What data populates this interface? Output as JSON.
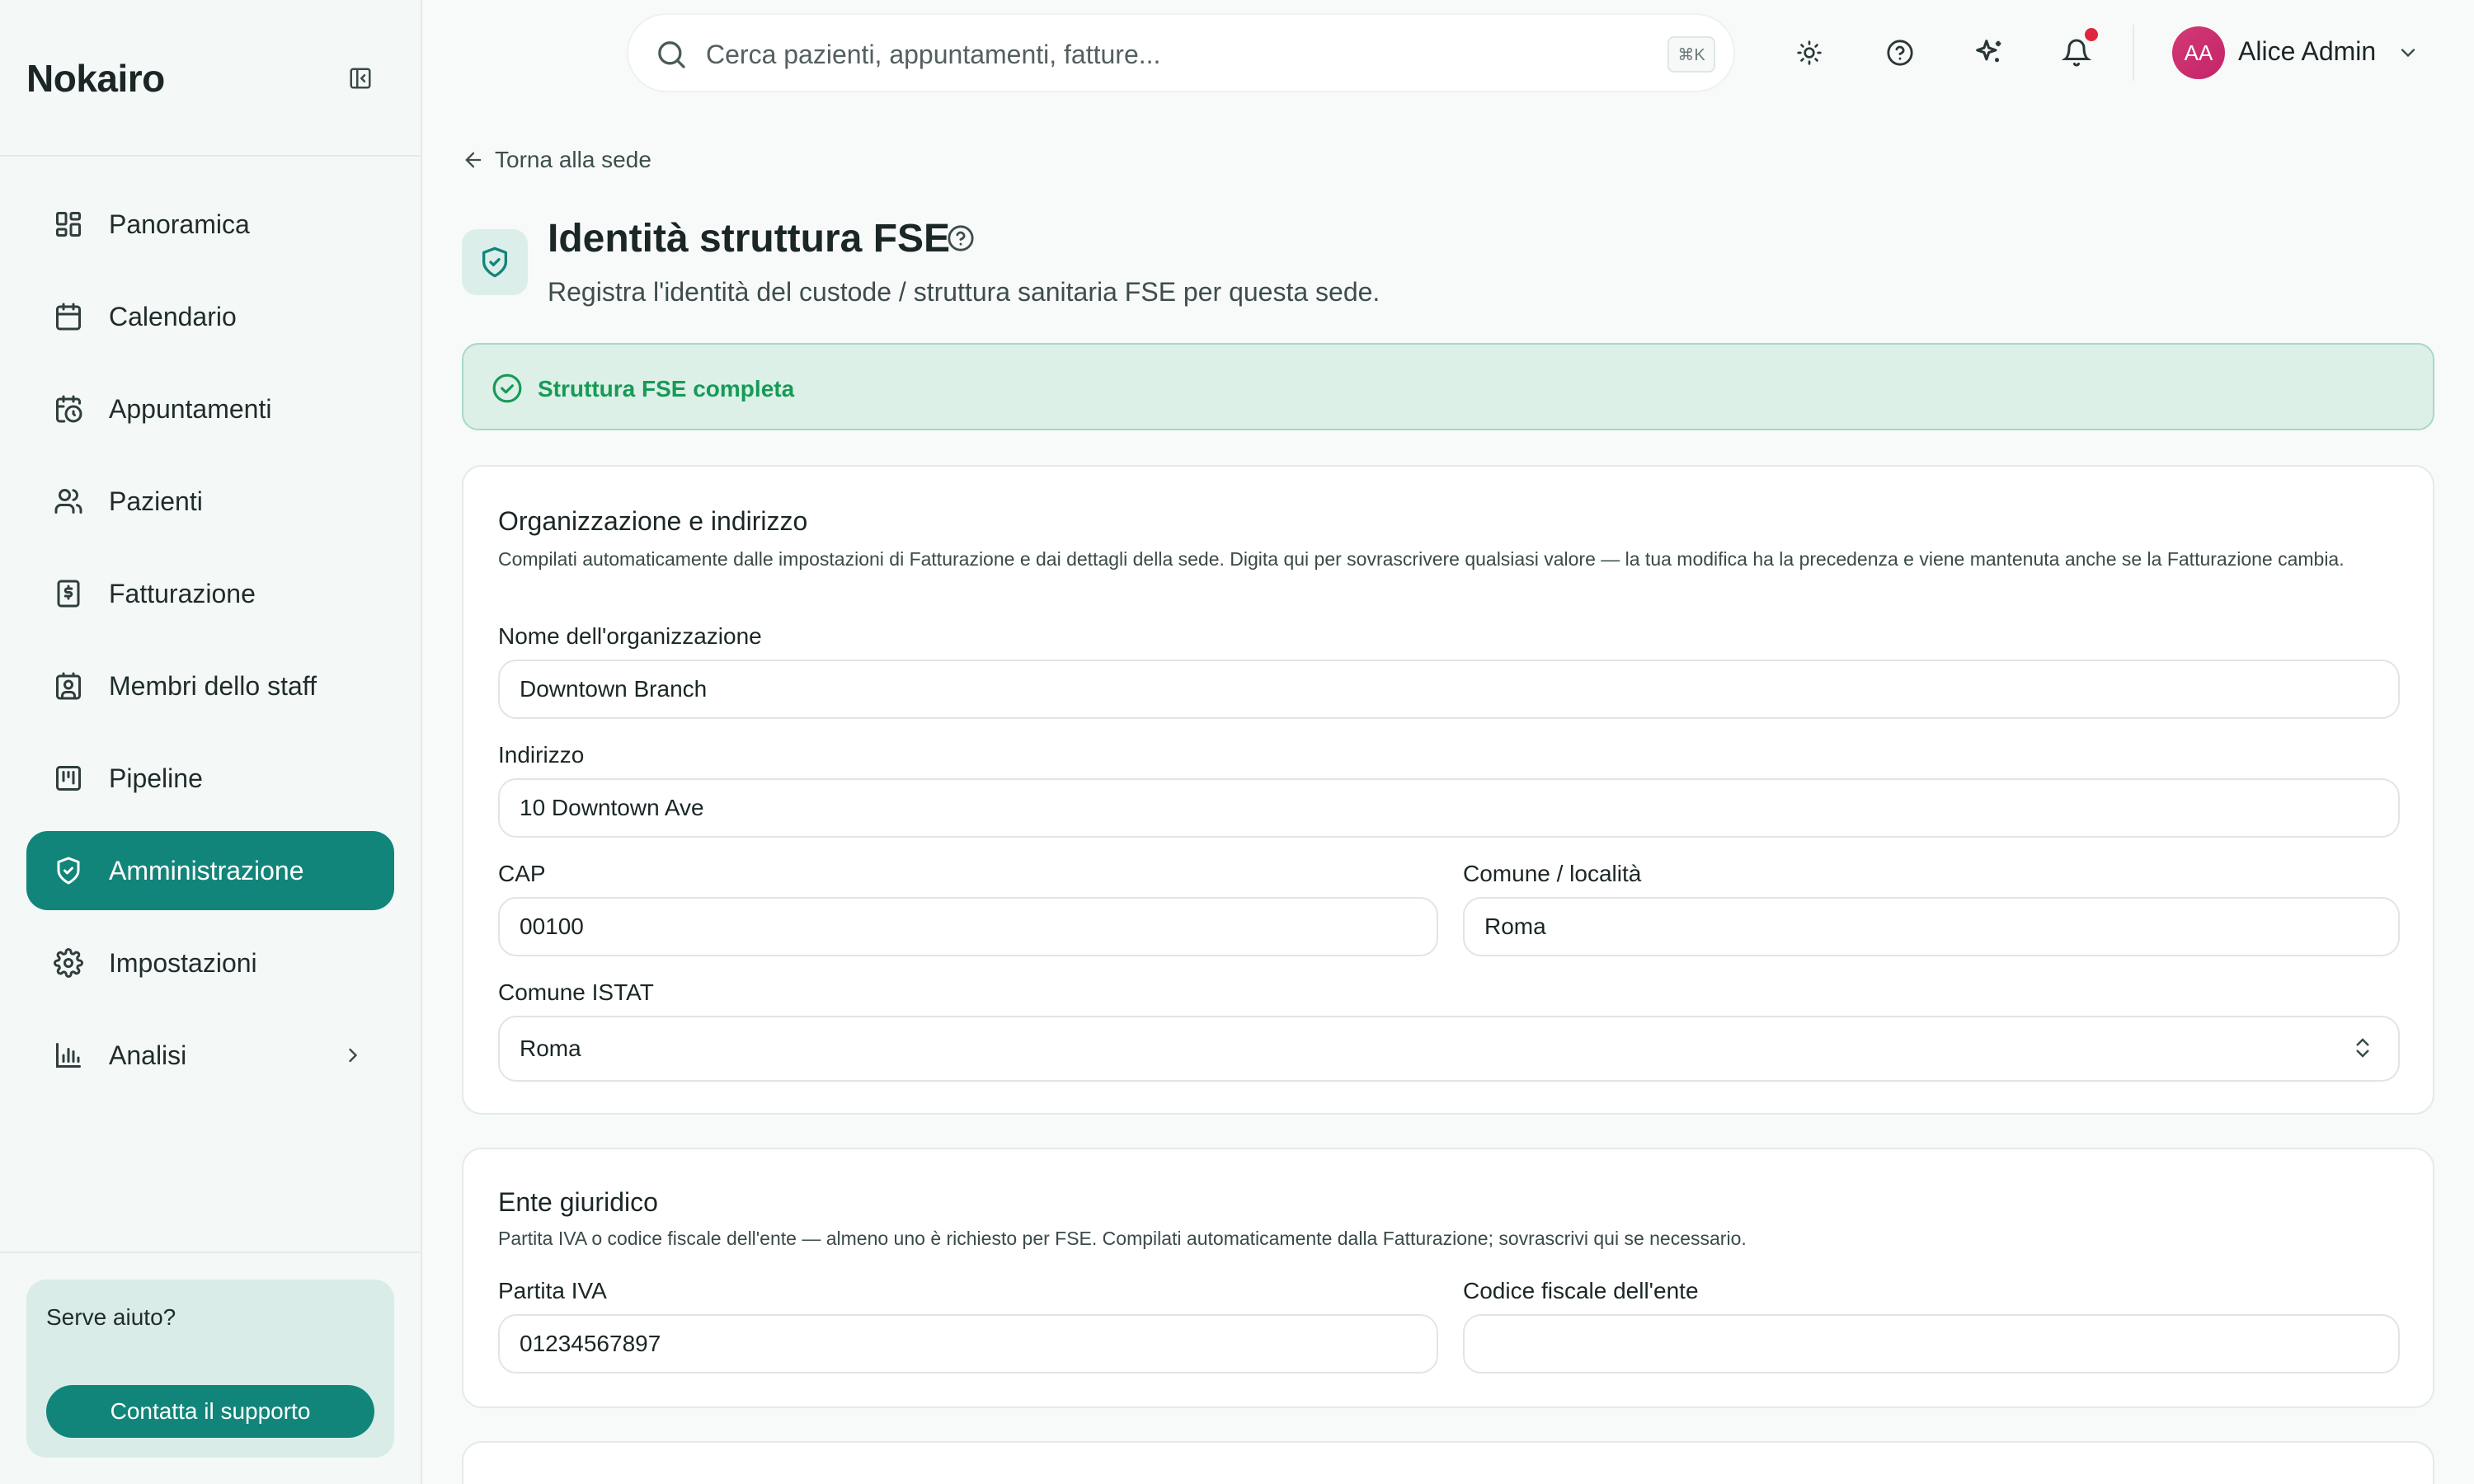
{
  "app": {
    "brand": "Nokairo"
  },
  "sidebar": {
    "items": [
      {
        "label": "Panoramica",
        "icon": "dashboard-icon"
      },
      {
        "label": "Calendario",
        "icon": "calendar-icon"
      },
      {
        "label": "Appuntamenti",
        "icon": "calendar-clock-icon"
      },
      {
        "label": "Pazienti",
        "icon": "users-icon"
      },
      {
        "label": "Fatturazione",
        "icon": "receipt-icon"
      },
      {
        "label": "Membri dello staff",
        "icon": "id-badge-icon"
      },
      {
        "label": "Pipeline",
        "icon": "kanban-icon"
      },
      {
        "label": "Amministrazione",
        "icon": "shield-icon",
        "active": true
      },
      {
        "label": "Impostazioni",
        "icon": "gear-icon"
      },
      {
        "label": "Analisi",
        "icon": "bar-chart-icon",
        "has_submenu": true
      }
    ],
    "help": {
      "title": "Serve aiuto?",
      "button": "Contatta il supporto"
    }
  },
  "topbar": {
    "search_placeholder": "Cerca pazienti, appuntamenti, fatture...",
    "shortcut": "⌘K",
    "icons": [
      "sun-icon",
      "help-circle-icon",
      "sparkles-icon",
      "bell-icon"
    ],
    "has_notification": true,
    "user": {
      "initials": "AA",
      "name": "Alice Admin"
    }
  },
  "main": {
    "back_link": "Torna alla sede",
    "title": "Identità struttura FSE",
    "subtitle": "Registra l'identità del custode / struttura sanitaria FSE per questa sede.",
    "status": "Struttura FSE completa",
    "org_card": {
      "title": "Organizzazione e indirizzo",
      "description": "Compilati automaticamente dalle impostazioni di Fatturazione e dai dettagli della sede. Digita qui per sovrascrivere qualsiasi valore — la tua modifica ha la precedenza e viene mantenuta anche se la Fatturazione cambia.",
      "org_name_label": "Nome dell'organizzazione",
      "org_name_value": "Downtown Branch",
      "address_label": "Indirizzo",
      "address_value": "10 Downtown Ave",
      "cap_label": "CAP",
      "cap_value": "00100",
      "city_label": "Comune / località",
      "city_value": "Roma",
      "istat_label": "Comune ISTAT",
      "istat_value": "Roma"
    },
    "legal_card": {
      "title": "Ente giuridico",
      "description": "Partita IVA o codice fiscale dell'ente — almeno uno è richiesto per FSE. Compilati automaticamente dalla Fatturazione; sovrascrivi qui se necessario.",
      "vat_label": "Partita IVA",
      "vat_value": "01234567897",
      "fiscal_code_label": "Codice fiscale dell'ente",
      "fiscal_code_value": ""
    }
  },
  "colors": {
    "accent": "#12857a",
    "sidebar_bg": "#f4f8f7",
    "success_bg": "#dcf0e8",
    "success_text": "#179a55",
    "notification": "#e0263f"
  }
}
